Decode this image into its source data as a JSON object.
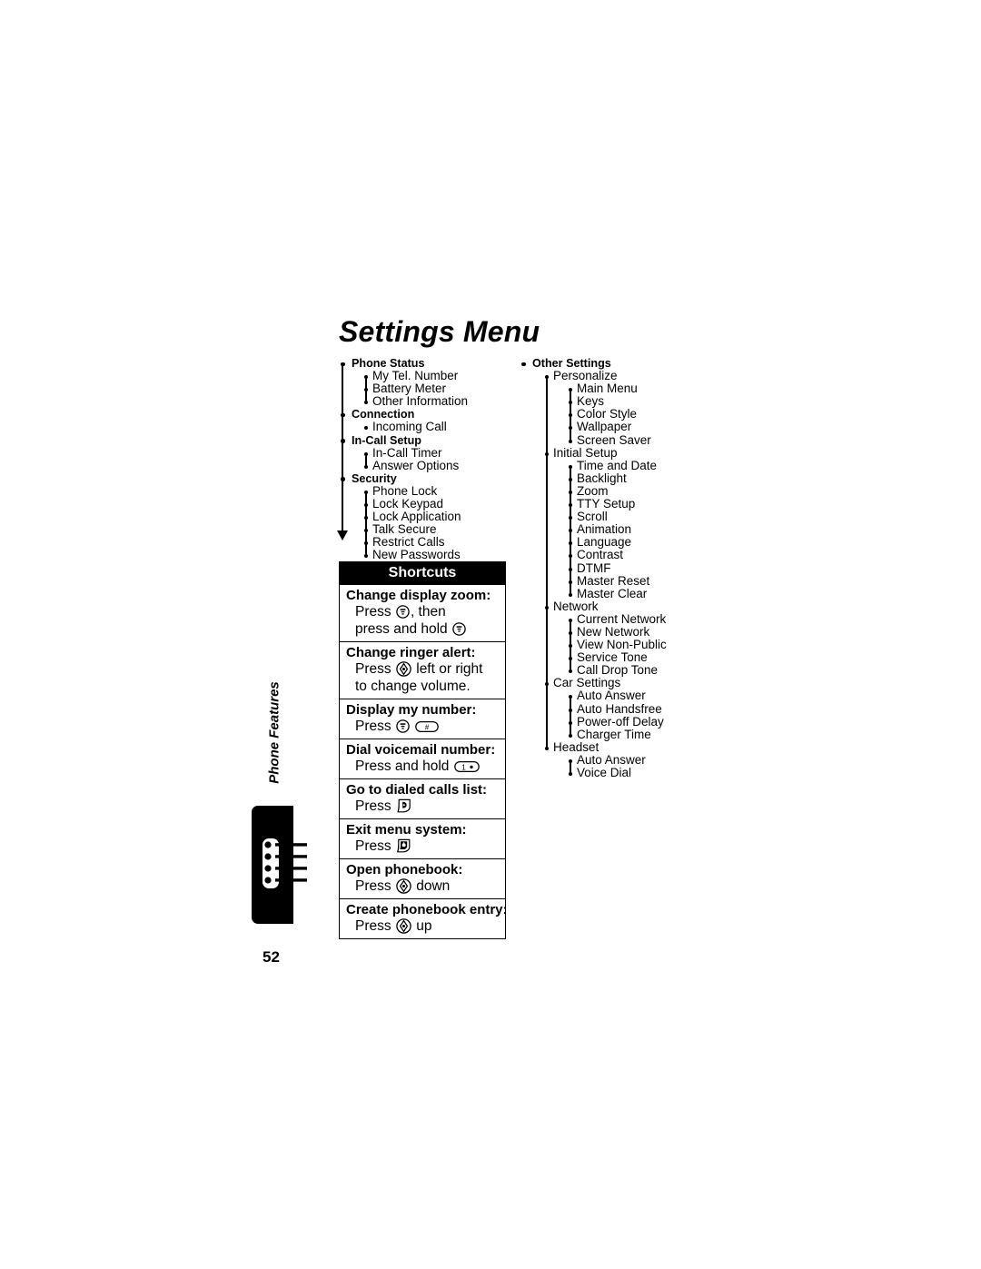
{
  "page": {
    "title": "Settings Menu",
    "number": "52",
    "side_tab_label": "Phone Features",
    "side_tab_icon": "phonebook-list-icon"
  },
  "menu_tree": {
    "left_column": [
      {
        "level": 0,
        "label": "Phone Status"
      },
      {
        "level": 1,
        "label": "My Tel. Number"
      },
      {
        "level": 1,
        "label": "Battery Meter"
      },
      {
        "level": 1,
        "label": "Other Information"
      },
      {
        "level": 0,
        "label": "Connection"
      },
      {
        "level": 1,
        "label": "Incoming Call"
      },
      {
        "level": 0,
        "label": "In-Call Setup"
      },
      {
        "level": 1,
        "label": "In-Call Timer"
      },
      {
        "level": 1,
        "label": "Answer Options"
      },
      {
        "level": 0,
        "label": "Security"
      },
      {
        "level": 1,
        "label": "Phone Lock"
      },
      {
        "level": 1,
        "label": "Lock Keypad"
      },
      {
        "level": 1,
        "label": "Lock Application"
      },
      {
        "level": 1,
        "label": "Talk Secure"
      },
      {
        "level": 1,
        "label": "Restrict Calls"
      },
      {
        "level": 1,
        "label": "New Passwords"
      }
    ],
    "right_column": [
      {
        "level": 0,
        "label": "Other Settings"
      },
      {
        "level": 1,
        "label": "Personalize"
      },
      {
        "level": 2,
        "label": "Main Menu"
      },
      {
        "level": 2,
        "label": "Keys"
      },
      {
        "level": 2,
        "label": "Color Style"
      },
      {
        "level": 2,
        "label": "Wallpaper"
      },
      {
        "level": 2,
        "label": "Screen Saver"
      },
      {
        "level": 1,
        "label": "Initial Setup"
      },
      {
        "level": 2,
        "label": "Time and Date"
      },
      {
        "level": 2,
        "label": "Backlight"
      },
      {
        "level": 2,
        "label": "Zoom"
      },
      {
        "level": 2,
        "label": "TTY Setup"
      },
      {
        "level": 2,
        "label": "Scroll"
      },
      {
        "level": 2,
        "label": "Animation"
      },
      {
        "level": 2,
        "label": "Language"
      },
      {
        "level": 2,
        "label": "Contrast"
      },
      {
        "level": 2,
        "label": "DTMF"
      },
      {
        "level": 2,
        "label": "Master Reset"
      },
      {
        "level": 2,
        "label": "Master Clear"
      },
      {
        "level": 1,
        "label": "Network"
      },
      {
        "level": 2,
        "label": "Current Network"
      },
      {
        "level": 2,
        "label": "New Network"
      },
      {
        "level": 2,
        "label": "View Non-Public"
      },
      {
        "level": 2,
        "label": "Service Tone"
      },
      {
        "level": 2,
        "label": "Call Drop Tone"
      },
      {
        "level": 1,
        "label": "Car Settings"
      },
      {
        "level": 2,
        "label": "Auto Answer"
      },
      {
        "level": 2,
        "label": "Auto Handsfree"
      },
      {
        "level": 2,
        "label": "Power-off Delay"
      },
      {
        "level": 2,
        "label": "Charger Time"
      },
      {
        "level": 1,
        "label": "Headset"
      },
      {
        "level": 2,
        "label": "Auto Answer"
      },
      {
        "level": 2,
        "label": "Voice Dial"
      }
    ]
  },
  "shortcuts": {
    "header": "Shortcuts",
    "items": [
      {
        "title": "Change display zoom:",
        "lines": [
          {
            "parts": [
              {
                "t": "text",
                "v": "Press "
              },
              {
                "t": "icon",
                "v": "menu-key-icon"
              },
              {
                "t": "text",
                "v": ", then"
              }
            ]
          },
          {
            "parts": [
              {
                "t": "text",
                "v": "press and hold "
              },
              {
                "t": "icon",
                "v": "menu-key-icon"
              }
            ]
          }
        ]
      },
      {
        "title": "Change ringer alert:",
        "lines": [
          {
            "parts": [
              {
                "t": "text",
                "v": "Press "
              },
              {
                "t": "icon",
                "v": "navigation-key-icon"
              },
              {
                "t": "text",
                "v": " left or right"
              }
            ]
          },
          {
            "parts": [
              {
                "t": "text",
                "v": "to change volume."
              }
            ]
          }
        ]
      },
      {
        "title": "Display my number:",
        "lines": [
          {
            "parts": [
              {
                "t": "text",
                "v": "Press "
              },
              {
                "t": "icon",
                "v": "menu-key-icon"
              },
              {
                "t": "text",
                "v": " "
              },
              {
                "t": "icon",
                "v": "pound-key-icon"
              }
            ]
          }
        ]
      },
      {
        "title": "Dial voicemail number:",
        "lines": [
          {
            "parts": [
              {
                "t": "text",
                "v": "Press and hold "
              },
              {
                "t": "icon",
                "v": "one-key-icon"
              }
            ]
          }
        ]
      },
      {
        "title": "Go to dialed calls list:",
        "lines": [
          {
            "parts": [
              {
                "t": "text",
                "v": "Press "
              },
              {
                "t": "icon",
                "v": "send-key-icon"
              }
            ]
          }
        ]
      },
      {
        "title": "Exit menu system:",
        "lines": [
          {
            "parts": [
              {
                "t": "text",
                "v": "Press "
              },
              {
                "t": "icon",
                "v": "end-key-icon"
              }
            ]
          }
        ]
      },
      {
        "title": "Open phonebook:",
        "lines": [
          {
            "parts": [
              {
                "t": "text",
                "v": "Press "
              },
              {
                "t": "icon",
                "v": "navigation-key-icon"
              },
              {
                "t": "text",
                "v": " down"
              }
            ]
          }
        ]
      },
      {
        "title": "Create phonebook entry:",
        "lines": [
          {
            "parts": [
              {
                "t": "text",
                "v": "Press "
              },
              {
                "t": "icon",
                "v": "navigation-key-icon"
              },
              {
                "t": "text",
                "v": " up"
              }
            ]
          }
        ]
      }
    ]
  },
  "colors": {
    "ink": "#000000",
    "paper": "#ffffff"
  }
}
